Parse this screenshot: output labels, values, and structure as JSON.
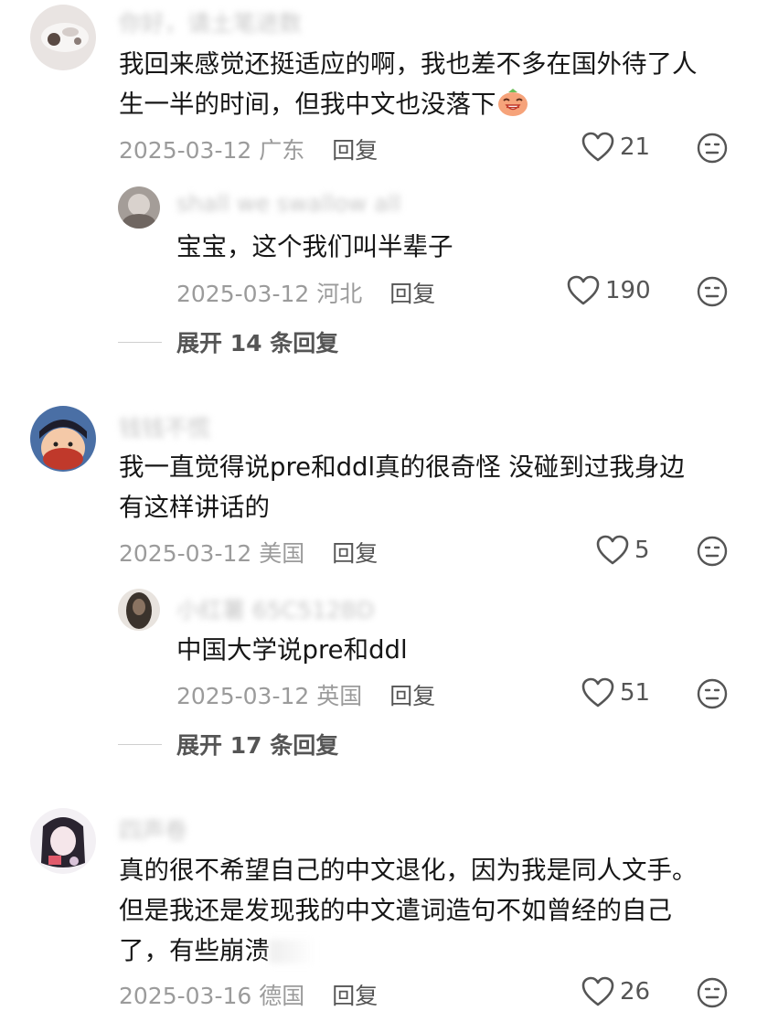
{
  "comments": [
    {
      "username": "你好，请土笔进数",
      "text_lines": [
        "我回来感觉还挺适应的啊，我也差不多在国外待了人",
        "生一半的时间，但我中文也没落下"
      ],
      "date": "2025-03-12",
      "location": "广东",
      "reply_label": "回复",
      "likes": "21",
      "replies": [
        {
          "username": "shall we swallow all",
          "text": "宝宝，这个我们叫半辈子",
          "date": "2025-03-12",
          "location": "河北",
          "reply_label": "回复",
          "likes": "190"
        }
      ],
      "expand_label": "展开 14 条回复"
    },
    {
      "username": "钱钱不慌",
      "text_lines": [
        "我一直觉得说pre和ddl真的很奇怪 没碰到过我身边",
        "有这样讲话的"
      ],
      "date": "2025-03-12",
      "location": "美国",
      "reply_label": "回复",
      "likes": "5",
      "replies": [
        {
          "username": "小红薯 65C512BD",
          "text": "中国大学说pre和ddl",
          "date": "2025-03-12",
          "location": "英国",
          "reply_label": "回复",
          "likes": "51"
        }
      ],
      "expand_label": "展开 17 条回复"
    },
    {
      "username": "四声卷",
      "text_lines": [
        "真的很不希望自己的中文退化，因为我是同人文手。",
        "但是我还是发现我的中文遣词造句不如曾经的自己",
        "了，有些崩溃"
      ],
      "date": "2025-03-16",
      "location": "德国",
      "reply_label": "回复",
      "likes": "26"
    }
  ],
  "icons": {
    "like": "heart-outline-icon",
    "dislike": "neutral-face-icon",
    "emoji": "laughing-face-emoji"
  },
  "colors": {
    "meta_gray": "#9b9b9b",
    "text_dark": "#161616",
    "action_gray": "#555555"
  }
}
